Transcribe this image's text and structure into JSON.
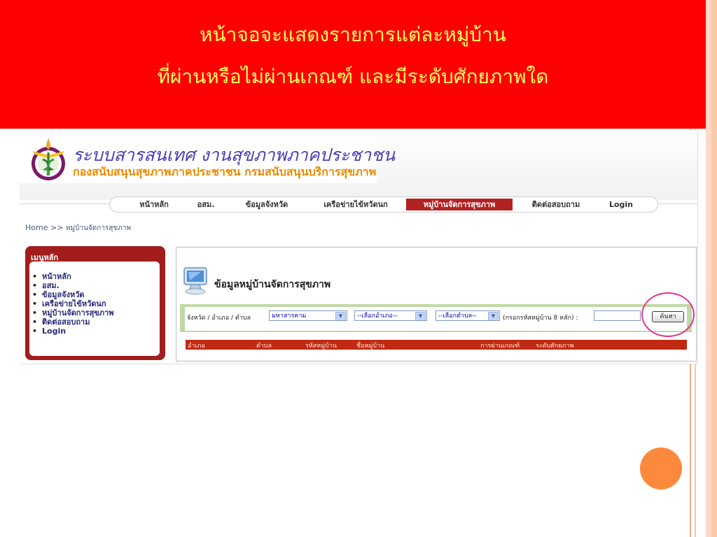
{
  "banner": {
    "line1": "หน้าจอจะแสดงรายการแต่ละหมู่บ้าน",
    "line2": "ที่ผ่านหรือไม่ผ่านเกณฑ์ และมีระดับศักยภาพใด"
  },
  "site": {
    "title": "ระบบสารสนเทศ งานสุขภาพภาคประชาชน",
    "subtitle": "กองสนับสนุนสุขภาพภาคประชาชน กรมสนับสนุนบริการสุขภาพ"
  },
  "nav": {
    "items": [
      {
        "label": "หน้าหลัก",
        "active": false
      },
      {
        "label": "อสม.",
        "active": false
      },
      {
        "label": "ข้อมูลจังหวัด",
        "active": false
      },
      {
        "label": "เครือข่ายไข้หวัดนก",
        "active": false
      },
      {
        "label": "หมู่บ้านจัดการสุขภาพ",
        "active": true
      },
      {
        "label": "ติดต่อสอบถาม",
        "active": false
      },
      {
        "label": "Login",
        "active": false
      }
    ]
  },
  "breadcrumb": {
    "home": "Home",
    "separator": ">>",
    "current": "หมู่บ้านจัดการสุขภาพ"
  },
  "menu": {
    "title": "เมนูหลัก",
    "items": [
      "หน้าหลัก",
      "อสม.",
      "ข้อมูลจังหวัด",
      "เครือข่ายไข้หวัดนก",
      "หมู่บ้านจัดการสุขภาพ",
      "ติดต่อสอบถาม",
      "Login"
    ]
  },
  "content": {
    "title": "ข้อมูลหมู่บ้านจัดการสุขภาพ",
    "filter_label": "จังหวัด / อำเภอ / ตำบล",
    "province_select": "มหาสารคาม",
    "district_select": "--เลือกอำเภอ--",
    "subdistrict_select": "--เลือกตำบล--",
    "code_label": "(กรอกรหัสหมู่บ้าน 8 หลัก) :",
    "code_value": "",
    "search_button": "ค้นหา"
  },
  "table": {
    "headers": [
      "อำเภอ",
      "ตำบล",
      "รหัสหมู่บ้าน",
      "ชื่อหมู่บ้าน",
      "การผ่านเกณฑ์",
      "ระดับศักยภาพ"
    ]
  },
  "colors": {
    "banner_bg": "#fe0000",
    "banner_text": "#ffff66",
    "nav_active": "#b22222",
    "menu_bg": "#a31d1d",
    "filter_bg": "#bfd9a6",
    "table_header_bg": "#c12a12",
    "highlight": "#e5338f"
  }
}
